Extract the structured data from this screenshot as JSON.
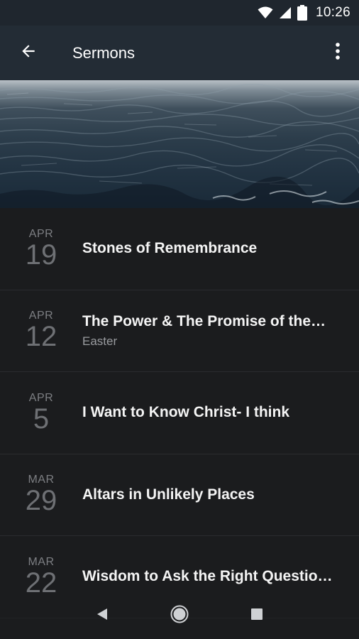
{
  "status_bar": {
    "time": "10:26"
  },
  "app_bar": {
    "title": "Sermons"
  },
  "sermons": [
    {
      "month": "APR",
      "day": "19",
      "title": "Stones of Remembrance",
      "subtitle": ""
    },
    {
      "month": "APR",
      "day": "12",
      "title": "The Power & The Promise of the…",
      "subtitle": "Easter"
    },
    {
      "month": "APR",
      "day": "5",
      "title": "I Want to Know Christ- I think",
      "subtitle": ""
    },
    {
      "month": "MAR",
      "day": "29",
      "title": "Altars in Unlikely Places",
      "subtitle": ""
    },
    {
      "month": "MAR",
      "day": "22",
      "title": "Wisdom to Ask the Right Questio…",
      "subtitle": ""
    }
  ],
  "icons": {
    "back": "arrow-back-icon",
    "more": "more-vert-icon",
    "wifi": "wifi-icon",
    "signal": "signal-icon",
    "battery": "battery-icon",
    "nav_back": "nav-back-icon",
    "nav_home": "nav-home-icon",
    "nav_recents": "nav-recents-icon"
  },
  "colors": {
    "app_bar": "#232c35",
    "background": "#1b1c1e",
    "date_text": "#6e7074"
  }
}
